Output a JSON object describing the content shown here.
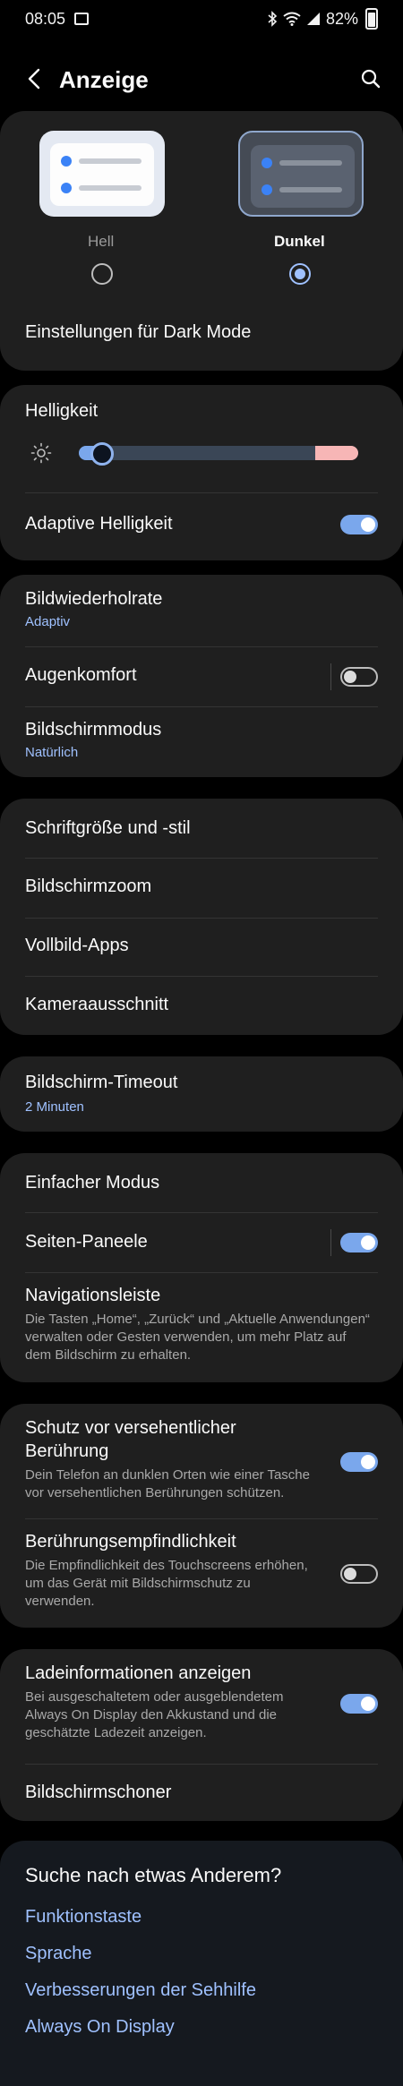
{
  "status_bar": {
    "time": "08:05",
    "battery": "82%"
  },
  "header": {
    "title": "Anzeige"
  },
  "theme": {
    "light_label": "Hell",
    "dark_label": "Dunkel",
    "selected": "dark",
    "dark_mode_settings": "Einstellungen für Dark Mode"
  },
  "brightness": {
    "title": "Helligkeit",
    "level": 0.05,
    "adaptive_label": "Adaptive Helligkeit",
    "adaptive_on": true
  },
  "display": {
    "refresh_title": "Bildwiederholrate",
    "refresh_value": "Adaptiv",
    "eye_comfort": "Augenkomfort",
    "eye_comfort_on": false,
    "screen_mode_title": "Bildschirmmodus",
    "screen_mode_value": "Natürlich"
  },
  "appearance": {
    "font": "Schriftgröße und -stil",
    "zoom": "Bildschirmzoom",
    "fullscreen": "Vollbild-Apps",
    "camera_cutout": "Kameraausschnitt"
  },
  "timeout": {
    "title": "Bildschirm-Timeout",
    "value": "2 Minuten"
  },
  "misc": {
    "easy_mode": "Einfacher Modus",
    "edge_panels": "Seiten-Paneele",
    "edge_panels_on": true,
    "navbar_title": "Navigationsleiste",
    "navbar_desc": "Die Tasten „Home“, „Zurück“ und „Aktuelle Anwendungen“ verwalten oder Gesten verwenden, um mehr Platz auf dem Bildschirm zu erhalten."
  },
  "protection": {
    "accidental_title_1": "Schutz vor versehentlicher",
    "accidental_title_2": "Berührung",
    "accidental_desc": "Dein Telefon an dunklen Orten wie einer Tasche vor versehentlichen Berührungen schützen.",
    "accidental_on": true,
    "touch_title": "Berührungsempfindlichkeit",
    "touch_desc": "Die Empfindlichkeit des Touchscreens erhöhen, um das Gerät mit Bildschirmschutz zu verwenden.",
    "touch_on": false
  },
  "charging": {
    "info_title": "Ladeinformationen anzeigen",
    "info_desc": "Bei ausgeschaltetem oder ausgeblendetem Always On Display den Akkustand und die geschätzte Ladezeit anzeigen.",
    "info_on": true,
    "screensaver": "Bildschirmschoner"
  },
  "suggestions": {
    "heading": "Suche nach etwas Anderem?",
    "links": [
      "Funktionstaste",
      "Sprache",
      "Verbesserungen der Sehhilfe",
      "Always On Display"
    ]
  },
  "colors": {
    "accent": "#9fc1ff",
    "toggle_on": "#7aa7ec",
    "card": "#1f1f1f"
  },
  "icons": [
    "image-icon",
    "bluetooth-icon",
    "wifi-icon",
    "signal-icon",
    "battery-icon",
    "back-arrow-icon",
    "search-icon",
    "brightness-icon"
  ]
}
